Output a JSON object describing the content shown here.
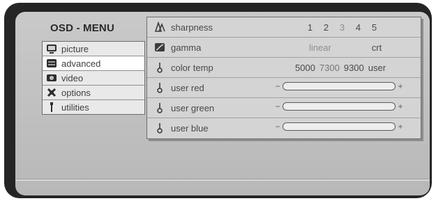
{
  "osd": {
    "title": "OSD - MENU"
  },
  "side_menu": {
    "items": [
      {
        "label": "picture",
        "icon": "monitor-icon",
        "active": false
      },
      {
        "label": "advanced",
        "icon": "advanced-icon",
        "active": true
      },
      {
        "label": "video",
        "icon": "camera-icon",
        "active": false
      },
      {
        "label": "options",
        "icon": "options-icon",
        "active": false
      },
      {
        "label": "utilities",
        "icon": "wrench-icon",
        "active": false
      }
    ]
  },
  "panel": {
    "sharpness": {
      "label": "sharpness",
      "icon": "sharpness-icon",
      "values": [
        "1",
        "2",
        "3",
        "4",
        "5"
      ]
    },
    "gamma": {
      "label": "gamma",
      "icon": "gamma-icon",
      "values": [
        "linear",
        "crt"
      ]
    },
    "color_temp": {
      "label": "color temp",
      "icon": "color-temp-icon",
      "values": [
        "5000",
        "7300",
        "9300",
        "user"
      ]
    },
    "user_red": {
      "label": "user red",
      "minus": "−",
      "plus": "+",
      "icon": "red-adjust-icon"
    },
    "user_green": {
      "label": "user green",
      "minus": "−",
      "plus": "+",
      "icon": "green-adjust-icon"
    },
    "user_blue": {
      "label": "user blue",
      "minus": "−",
      "plus": "+",
      "icon": "blue-adjust-icon"
    }
  }
}
